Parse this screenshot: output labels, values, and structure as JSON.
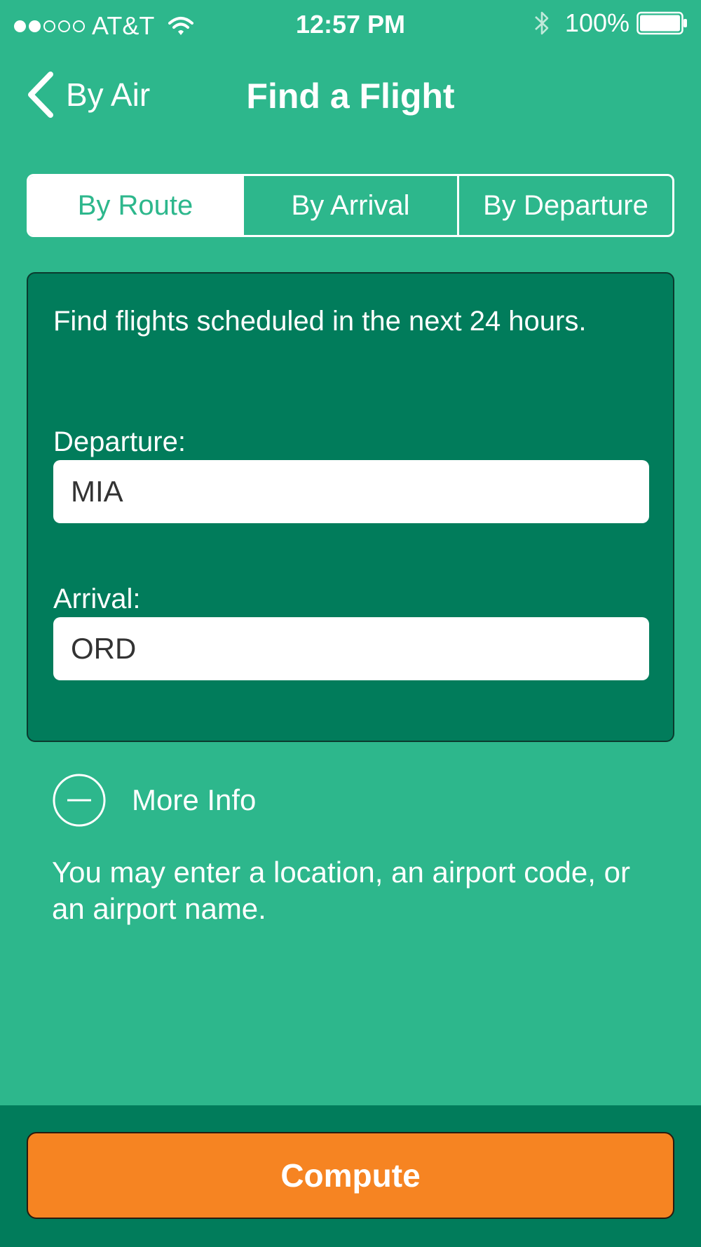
{
  "status_bar": {
    "signal_bars_filled": 2,
    "signal_bars_total": 5,
    "carrier": "AT&T",
    "time": "12:57 PM",
    "battery_percent": "100%",
    "icons": [
      "wifi-icon",
      "bluetooth-icon",
      "battery-icon"
    ]
  },
  "nav": {
    "back_label": "By Air",
    "title": "Find a Flight"
  },
  "segments": [
    {
      "label": "By Route",
      "selected": true
    },
    {
      "label": "By Arrival",
      "selected": false
    },
    {
      "label": "By Departure",
      "selected": false
    }
  ],
  "card": {
    "description": "Find flights scheduled in the next 24 hours.",
    "departure_label": "Departure:",
    "departure_value": "MIA",
    "arrival_label": "Arrival:",
    "arrival_value": "ORD"
  },
  "more_info": {
    "label": "More Info",
    "icon": "minus-circle-icon",
    "hint": "You may enter a location, an airport code, or an airport name."
  },
  "footer": {
    "compute_label": "Compute"
  },
  "colors": {
    "background": "#2db78c",
    "card": "#017c5b",
    "accent_button": "#f68422"
  }
}
